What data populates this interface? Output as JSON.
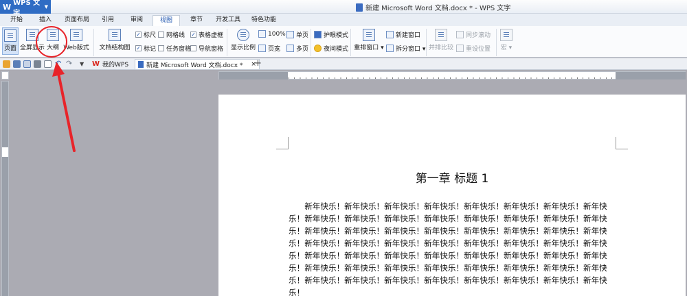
{
  "app": {
    "brand": "WPS 文字",
    "window_title": "新建 Microsoft Word 文档.docx * - WPS 文字"
  },
  "menu": {
    "tabs": [
      {
        "label": "开始",
        "active": false
      },
      {
        "label": "插入",
        "active": false
      },
      {
        "label": "页面布局",
        "active": false
      },
      {
        "label": "引用",
        "active": false
      },
      {
        "label": "审阅",
        "active": false
      },
      {
        "label": "视图",
        "active": true
      },
      {
        "label": "章节",
        "active": false
      },
      {
        "label": "开发工具",
        "active": false
      },
      {
        "label": "特色功能",
        "active": false
      }
    ]
  },
  "ribbon": {
    "page": "页面",
    "fullscreen": "全屏显示",
    "outline": "大纲",
    "web": "Web版式",
    "doc_structure": "文档结构图",
    "ruler": "标尺",
    "gridlines": "网格线",
    "table_border": "表格虚框",
    "mark": "标记",
    "task_pane": "任务窗格",
    "nav_pane": "导航窗格",
    "zoom": "显示比例",
    "zoom_100": "100%",
    "one_page": "单页",
    "page_width": "页宽",
    "multi_page": "多页",
    "eye_mode": "护眼模式",
    "night_mode": "夜间模式",
    "rearrange": "重排窗口",
    "new_window": "新建窗口",
    "split_window": "拆分窗口",
    "side_by_side": "并排比较",
    "sync_scroll": "同步滚动",
    "reset_pos": "重设位置",
    "macro": "宏"
  },
  "doc_tabs": {
    "home": "我的WPS",
    "doc": "新建 Microsoft Word 文档.docx *"
  },
  "document": {
    "chapter": "第一章  标题 1",
    "body": "新年快乐！新年快乐！新年快乐！新年快乐！新年快乐！新年快乐！新年快乐！新年快乐！新年快乐！新年快乐！新年快乐！新年快乐！新年快乐！新年快乐！新年快乐！新年快乐！新年快乐！新年快乐！新年快乐！新年快乐！新年快乐！新年快乐！新年快乐！新年快乐！新年快乐！新年快乐！新年快乐！新年快乐！新年快乐！新年快乐！新年快乐！新年快乐！新年快乐！新年快乐！新年快乐！新年快乐！新年快乐！新年快乐！新年快乐！新年快乐！新年快乐！新年快乐！新年快乐！新年快乐！新年快乐！新年快乐！新年快乐！新年快乐！新年快乐！新年快乐！新年快乐！新年快乐！新年快乐！新年快乐！新年快乐！新年快乐！"
  },
  "colors": {
    "accent": "#2f6cc4",
    "annotation": "#e8242a"
  }
}
